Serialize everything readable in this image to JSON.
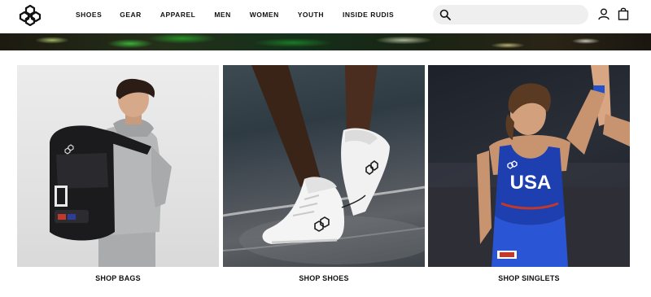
{
  "header": {
    "logo_icon": "rudis-hex-logo-icon",
    "nav": [
      {
        "label": "SHOES"
      },
      {
        "label": "GEAR"
      },
      {
        "label": "APPAREL"
      },
      {
        "label": "MEN"
      },
      {
        "label": "WOMEN"
      },
      {
        "label": "YOUTH"
      },
      {
        "label": "INSIDE RUDIS"
      }
    ],
    "search": {
      "placeholder": "",
      "value": "",
      "icon": "search-icon"
    },
    "account_icon": "user-icon",
    "cart_icon": "shopping-bag-icon"
  },
  "hero": {
    "image": "green-lit-water-banner"
  },
  "categories": [
    {
      "label": "SHOP BAGS",
      "image": "wrestler-with-black-backpack"
    },
    {
      "label": "SHOP SHOES",
      "image": "white-wrestling-shoes-on-mat"
    },
    {
      "label": "SHOP SINGLETS",
      "image": "wrestler-in-usa-singlet-arm-raised",
      "singlet_text": "USA"
    }
  ],
  "colors": {
    "text": "#111111",
    "search_bg": "#efefef",
    "singlet_blue": "#1d3fb0"
  }
}
